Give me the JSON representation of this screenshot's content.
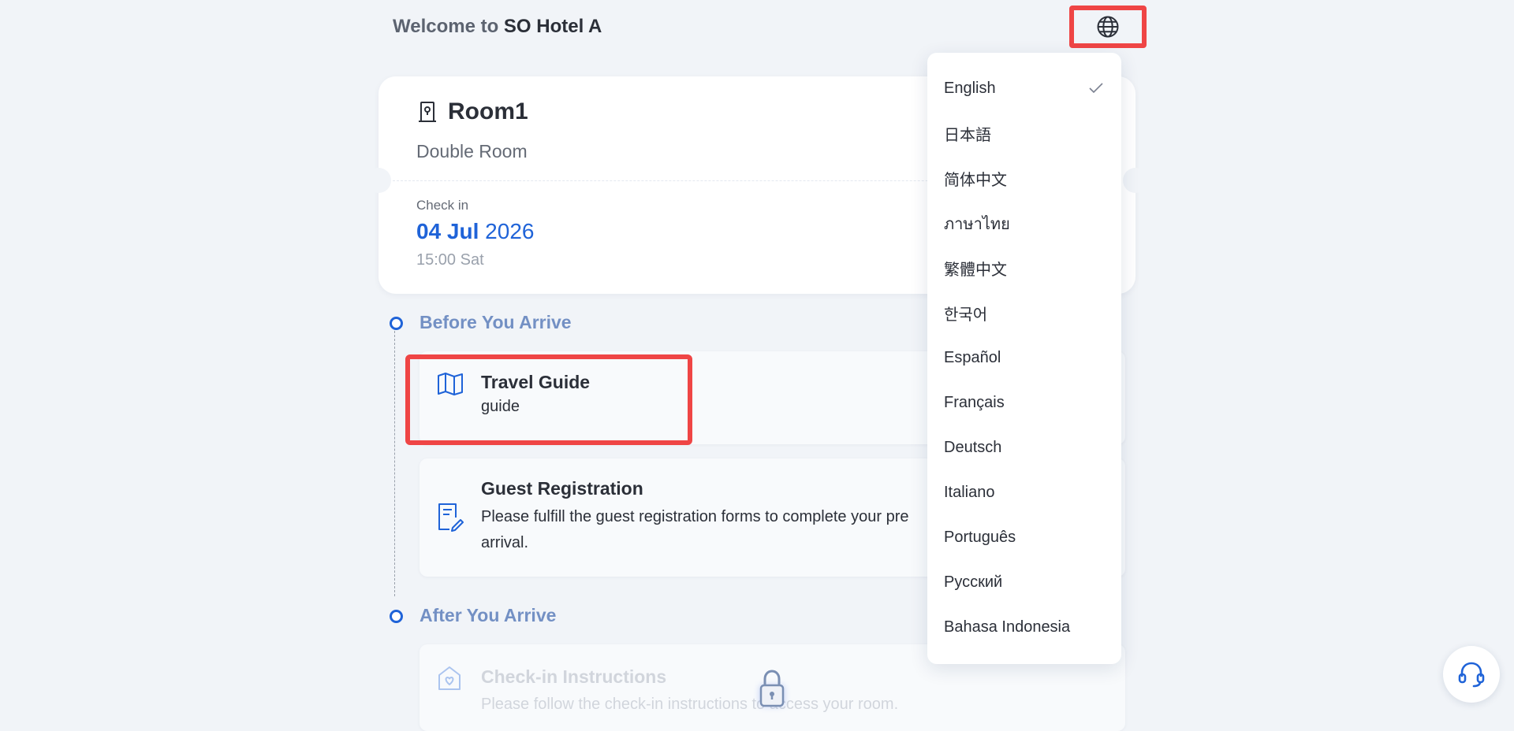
{
  "header": {
    "welcome_prefix": "Welcome to",
    "hotel_name": "SO Hotel A",
    "language_icon": "globe-icon"
  },
  "room": {
    "name": "Room1",
    "type": "Double Room",
    "checkin_label": "Check in",
    "checkin_day_month": "04 Jul",
    "checkin_year": "2026",
    "checkin_time": "15:00 Sat"
  },
  "sections": {
    "before": {
      "title": "Before You Arrive",
      "items": [
        {
          "title": "Travel Guide",
          "desc": "guide",
          "icon": "map-icon"
        },
        {
          "title": "Guest Registration",
          "desc_line1": "Please fulfill the guest registration forms to complete your pre",
          "desc_line2": "arrival.",
          "icon": "form-edit-icon"
        }
      ]
    },
    "after": {
      "title": "After You Arrive",
      "items": [
        {
          "title": "Check-in Instructions",
          "desc": "Please follow the check-in instructions to access your room.",
          "icon": "house-heart-icon"
        }
      ]
    }
  },
  "language_menu": {
    "selected": "English",
    "options": [
      "English",
      "日本語",
      "简体中文",
      "ภาษาไทย",
      "繁體中文",
      "한국어",
      "Español",
      "Français",
      "Deutsch",
      "Italiano",
      "Português",
      "Русский",
      "Bahasa Indonesia"
    ]
  },
  "colors": {
    "accent": "#1f63d8",
    "highlight": "#ef4545",
    "section_title": "#7390c4",
    "background": "#f1f4f8"
  }
}
